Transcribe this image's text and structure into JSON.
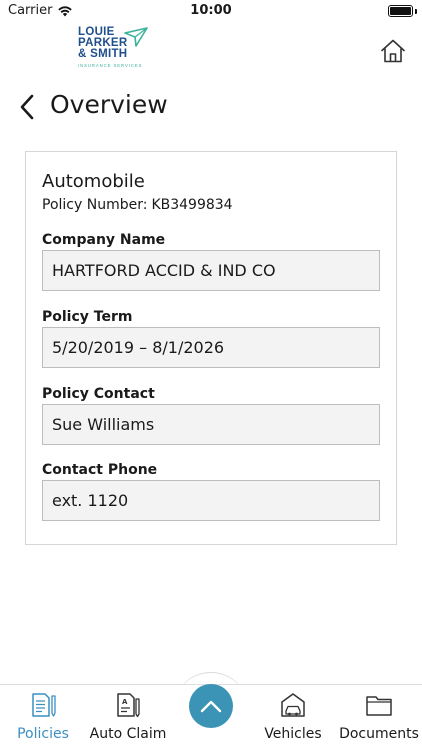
{
  "status_bar": {
    "carrier": "Carrier",
    "time": "10:00",
    "battery_level": 1.0
  },
  "header": {
    "logo": {
      "line1": "LOUIE",
      "line2": "PARKER",
      "line3": "& SMITH",
      "subtitle": "INSURANCE SERVICES"
    },
    "home_icon": "home-icon"
  },
  "nav": {
    "back_icon": "chevron-left-icon",
    "title": "Overview"
  },
  "policy": {
    "type": "Automobile",
    "number_label": "Policy Number:",
    "number": "KB3499834",
    "fields": [
      {
        "label": "Company Name",
        "value": "HARTFORD ACCID & IND CO"
      },
      {
        "label": "Policy Term",
        "value": "5/20/2019 – 8/1/2026"
      },
      {
        "label": "Policy Contact",
        "value": "Sue Williams"
      },
      {
        "label": "Contact Phone",
        "value": "ext. 1120"
      }
    ]
  },
  "tab_bar": {
    "tabs": [
      {
        "label": "Policies",
        "icon": "policies-icon",
        "active": true
      },
      {
        "label": "Auto Claim",
        "icon": "auto-claim-icon",
        "active": false
      },
      {
        "label": "Vehicles",
        "icon": "vehicles-icon",
        "active": false
      },
      {
        "label": "Documents",
        "icon": "documents-icon",
        "active": false
      }
    ],
    "center_button_icon": "chevron-up-icon"
  },
  "colors": {
    "accent": "#3b8fc1",
    "fab": "#3b93b6",
    "logo_blue": "#1e4f8c",
    "logo_green": "#3db29a",
    "field_bg": "#f3f3f3"
  }
}
